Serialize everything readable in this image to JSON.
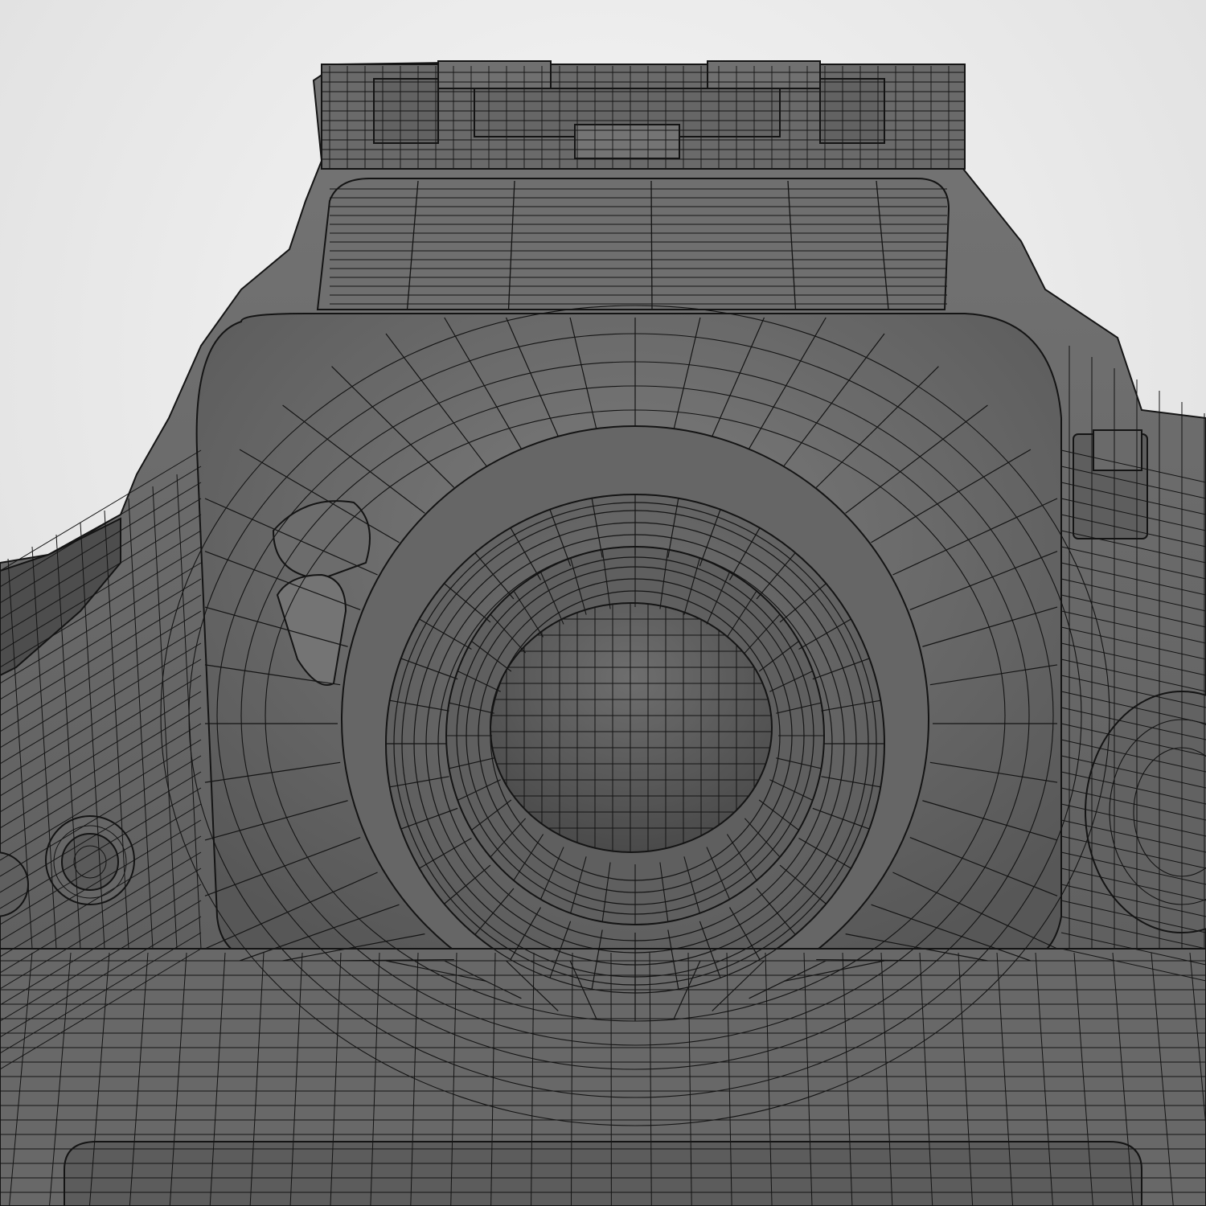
{
  "scene": {
    "subject": "camera-viewfinder-wireframe",
    "colors": {
      "background": "#f2f2f2",
      "background_shadow": "#d9d9d9",
      "body": "#6b6b6b",
      "body_light": "#7a7a7a",
      "body_dark": "#555555",
      "wire": "#141414",
      "ground": "#c8c8c8"
    }
  }
}
